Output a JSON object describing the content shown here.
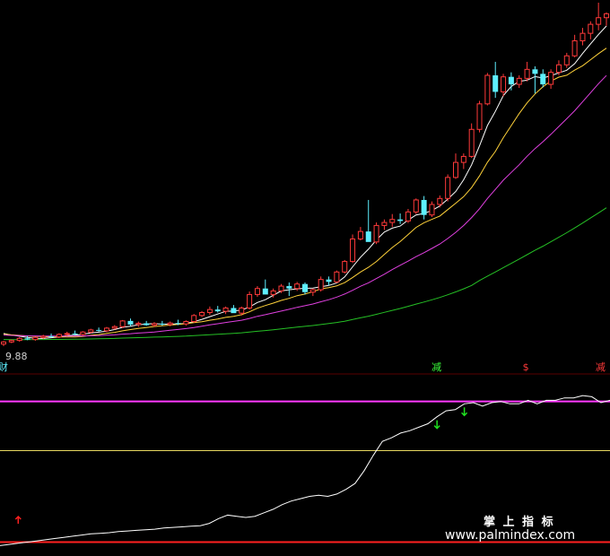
{
  "chart_data": [
    {
      "type": "candlestick",
      "price_low_label": "9.88",
      "up_color": "#ff3a3a",
      "down_color": "#5ef0ff",
      "ma_colors": [
        "#ffffff",
        "#ffd23a",
        "#e040e0",
        "#25c025"
      ],
      "candles": [
        [
          9.95,
          10.05,
          9.88,
          10.02
        ],
        [
          10.02,
          10.1,
          9.98,
          10.07
        ],
        [
          10.07,
          10.18,
          10.03,
          10.14
        ],
        [
          10.14,
          10.22,
          10.08,
          10.1
        ],
        [
          10.1,
          10.2,
          10.06,
          10.17
        ],
        [
          10.17,
          10.26,
          10.12,
          10.21
        ],
        [
          10.21,
          10.3,
          10.16,
          10.19
        ],
        [
          10.19,
          10.31,
          10.15,
          10.27
        ],
        [
          10.27,
          10.36,
          10.22,
          10.3
        ],
        [
          10.3,
          10.4,
          10.25,
          10.27
        ],
        [
          10.27,
          10.38,
          10.23,
          10.35
        ],
        [
          10.35,
          10.46,
          10.3,
          10.42
        ],
        [
          10.42,
          10.5,
          10.36,
          10.39
        ],
        [
          10.39,
          10.52,
          10.35,
          10.48
        ],
        [
          10.48,
          10.58,
          10.43,
          10.53
        ],
        [
          10.53,
          10.75,
          10.48,
          10.72
        ],
        [
          10.72,
          10.8,
          10.55,
          10.6
        ],
        [
          10.6,
          10.7,
          10.52,
          10.64
        ],
        [
          10.64,
          10.72,
          10.56,
          10.58
        ],
        [
          10.58,
          10.68,
          10.52,
          10.63
        ],
        [
          10.63,
          10.72,
          10.56,
          10.6
        ],
        [
          10.6,
          10.7,
          10.54,
          10.65
        ],
        [
          10.65,
          10.76,
          10.58,
          10.62
        ],
        [
          10.62,
          10.74,
          10.56,
          10.7
        ],
        [
          10.7,
          10.95,
          10.66,
          10.9
        ],
        [
          10.9,
          11.05,
          10.85,
          11.0
        ],
        [
          11.0,
          11.2,
          10.92,
          11.1
        ],
        [
          11.1,
          11.22,
          11.0,
          11.04
        ],
        [
          11.04,
          11.2,
          10.95,
          11.15
        ],
        [
          11.15,
          11.25,
          11.02,
          10.98
        ],
        [
          10.98,
          11.2,
          10.9,
          11.15
        ],
        [
          11.15,
          11.7,
          11.1,
          11.6
        ],
        [
          11.6,
          11.88,
          11.52,
          11.8
        ],
        [
          11.8,
          12.1,
          11.72,
          11.6
        ],
        [
          11.6,
          11.8,
          11.5,
          11.72
        ],
        [
          11.72,
          11.95,
          11.65,
          11.88
        ],
        [
          11.88,
          12.0,
          11.55,
          11.8
        ],
        [
          11.8,
          12.02,
          11.72,
          11.95
        ],
        [
          11.95,
          12.0,
          11.6,
          11.68
        ],
        [
          11.68,
          11.8,
          11.55,
          11.76
        ],
        [
          11.76,
          12.2,
          11.7,
          12.1
        ],
        [
          12.1,
          12.2,
          11.9,
          12.02
        ],
        [
          12.02,
          12.4,
          11.98,
          12.35
        ],
        [
          12.35,
          12.75,
          12.3,
          12.7
        ],
        [
          12.7,
          13.6,
          12.65,
          13.45
        ],
        [
          13.45,
          13.85,
          13.4,
          13.7
        ],
        [
          13.7,
          14.75,
          13.6,
          13.35
        ],
        [
          13.35,
          14.0,
          13.28,
          13.9
        ],
        [
          13.9,
          14.1,
          13.75,
          14.0
        ],
        [
          14.0,
          14.28,
          13.85,
          14.1
        ],
        [
          14.1,
          14.3,
          13.95,
          14.05
        ],
        [
          14.05,
          14.45,
          13.98,
          14.35
        ],
        [
          14.35,
          14.8,
          14.28,
          14.75
        ],
        [
          14.75,
          14.88,
          14.1,
          14.25
        ],
        [
          14.25,
          14.7,
          14.18,
          14.6
        ],
        [
          14.6,
          14.9,
          14.5,
          14.8
        ],
        [
          14.8,
          15.6,
          14.7,
          15.5
        ],
        [
          15.5,
          16.3,
          15.45,
          16.0
        ],
        [
          16.0,
          16.3,
          15.78,
          16.2
        ],
        [
          16.2,
          17.3,
          16.15,
          17.1
        ],
        [
          17.1,
          18.05,
          17.0,
          17.95
        ],
        [
          17.95,
          18.98,
          17.9,
          18.9
        ],
        [
          18.9,
          19.35,
          18.15,
          18.35
        ],
        [
          18.35,
          18.95,
          18.2,
          18.85
        ],
        [
          18.85,
          19.0,
          18.4,
          18.6
        ],
        [
          18.6,
          18.9,
          18.48,
          18.8
        ],
        [
          18.8,
          19.35,
          18.7,
          19.1
        ],
        [
          19.1,
          19.2,
          18.3,
          18.95
        ],
        [
          18.95,
          19.1,
          18.5,
          18.6
        ],
        [
          18.6,
          19.1,
          18.45,
          19.0
        ],
        [
          19.0,
          19.4,
          18.9,
          19.25
        ],
        [
          19.25,
          19.65,
          19.15,
          19.55
        ],
        [
          19.55,
          20.25,
          19.5,
          20.05
        ],
        [
          20.05,
          20.48,
          19.9,
          20.3
        ],
        [
          20.3,
          20.7,
          20.1,
          20.6
        ],
        [
          20.6,
          21.32,
          20.4,
          20.82
        ],
        [
          20.82,
          21.0,
          20.55,
          20.95
        ]
      ]
    },
    {
      "type": "line",
      "indicator": [
        2,
        3,
        4,
        5,
        6,
        7,
        8,
        9,
        10,
        11,
        12,
        12.5,
        13,
        14,
        14.5,
        15,
        15.5,
        16,
        17,
        17.5,
        18,
        18.5,
        19,
        21,
        25,
        28,
        27,
        26,
        27,
        30,
        33,
        37,
        40,
        42,
        44,
        45,
        44,
        46,
        50,
        55,
        66,
        79,
        91,
        94,
        98,
        100,
        103,
        106,
        112,
        117,
        118,
        123,
        124,
        121,
        124,
        125,
        123,
        123,
        126,
        123,
        126,
        126,
        128,
        128,
        130,
        129,
        124,
        126
      ],
      "signal_levels": [
        125,
        83,
        5
      ],
      "signal_colors": [
        "#ff3aff",
        "#e8d860",
        "#ff2020"
      ],
      "signals": [
        {
          "text": "减",
          "color": "#3aff3a",
          "type": "label"
        },
        {
          "text": "$",
          "color": "#ff3a3a",
          "type": "label"
        },
        {
          "text": "减",
          "color": "#ff3a3a",
          "type": "label"
        }
      ],
      "arrows": [
        {
          "dir": "up",
          "color": "#ff2020"
        },
        {
          "dir": "down",
          "color": "#20e020"
        },
        {
          "dir": "down",
          "color": "#20e020"
        }
      ],
      "side_label": "财"
    }
  ],
  "watermark": {
    "cn": "掌 上 指 标",
    "url": "www.palmindex.com"
  }
}
